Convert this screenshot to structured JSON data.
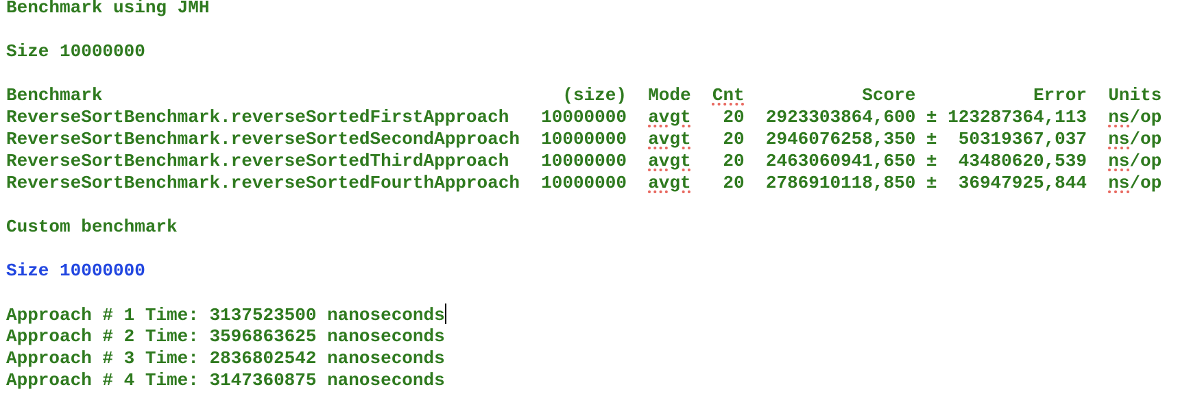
{
  "jmh_title": "Benchmark using JMH",
  "jmh_size": "Size 10000000",
  "table": {
    "headers": {
      "benchmark": "Benchmark",
      "size": "(size)",
      "mode": "Mode",
      "cnt": "Cnt",
      "score": "Score",
      "error": "Error",
      "units": "Units"
    },
    "rows": [
      {
        "benchmark": "ReverseSortBenchmark.reverseSortedFirstApproach",
        "size": "10000000",
        "mode": "avgt",
        "cnt": "20",
        "score": "2923303864,600",
        "pm": "±",
        "error": "123287364,113",
        "units": "ns/op"
      },
      {
        "benchmark": "ReverseSortBenchmark.reverseSortedSecondApproach",
        "size": "10000000",
        "mode": "avgt",
        "cnt": "20",
        "score": "2946076258,350",
        "pm": "±",
        "error": "50319367,037",
        "units": "ns/op"
      },
      {
        "benchmark": "ReverseSortBenchmark.reverseSortedThirdApproach",
        "size": "10000000",
        "mode": "avgt",
        "cnt": "20",
        "score": "2463060941,650",
        "pm": "±",
        "error": "43480620,539",
        "units": "ns/op"
      },
      {
        "benchmark": "ReverseSortBenchmark.reverseSortedFourthApproach",
        "size": "10000000",
        "mode": "avgt",
        "cnt": "20",
        "score": "2786910118,850",
        "pm": "±",
        "error": "36947925,844",
        "units": "ns/op"
      }
    ]
  },
  "custom_title": "Custom benchmark",
  "custom_size": "Size 10000000",
  "approaches": [
    "Approach # 1 Time: 3137523500 nanoseconds",
    "Approach # 2 Time: 3596863625 nanoseconds",
    "Approach # 3 Time: 2836802542 nanoseconds",
    "Approach # 4 Time: 3147360875 nanoseconds"
  ],
  "colors": {
    "text": "#2f7a1f",
    "highlight": "#2146e0",
    "spellcheck": "#e8685f"
  }
}
